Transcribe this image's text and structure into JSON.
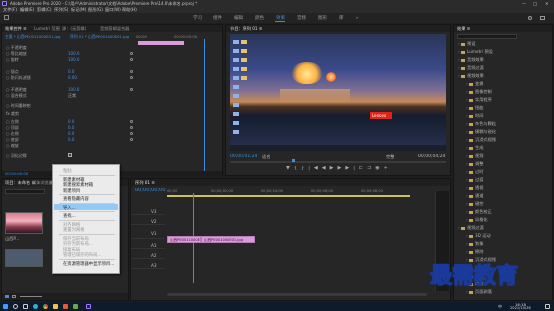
{
  "window": {
    "title": "Adobe Premiere Pro 2020 - C:\\用户\\Administrator\\文档\\Adobe\\Premiere Pro\\14.0\\未命名.prproj *"
  },
  "menubar": [
    "文件(F)",
    "编辑(E)",
    "剪辑(C)",
    "序列(S)",
    "标记(M)",
    "图形(G)",
    "窗口(W)",
    "帮助(H)"
  ],
  "workspaces": [
    {
      "label": "学习",
      "active": false
    },
    {
      "label": "组件",
      "active": false
    },
    {
      "label": "编辑",
      "active": false
    },
    {
      "label": "颜色",
      "active": false
    },
    {
      "label": "效果",
      "active": true
    },
    {
      "label": "音频",
      "active": false
    },
    {
      "label": "图形",
      "active": false
    },
    {
      "label": "库",
      "active": false
    }
  ],
  "effect_controls": {
    "tabs": [
      "效果控件 ≡",
      "Lumetri 范围",
      "源：(无剪辑)",
      "音频剪辑混合器"
    ],
    "source_label": "主要 * 山西PE0011000E01.jpg",
    "seq_label": "序列 01 * 山西PE001000E01.jpg",
    "timecode_left": "00:00",
    "timecode_right": "00:00:05:00",
    "rows": [
      {
        "label": "○ 不透明度",
        "value": ""
      },
      {
        "label": "  ○ 等比缩放",
        "value": "100.0"
      },
      {
        "label": "  ○ 旋转",
        "value": "100.0"
      },
      {
        "label": "  ○ 锚点",
        "value": "0.0"
      },
      {
        "label": "  ○ 防闪烁滤镜",
        "value": "0.00"
      },
      {
        "label": "○ 不透明度",
        "value": "100.0"
      },
      {
        "label": "  ○ 混合模式",
        "value": "正常"
      },
      {
        "label": "  ○ 时间重映射",
        "value": ""
      },
      {
        "label": "fx 裁剪",
        "value": ""
      },
      {
        "label": "  ○ 左侧",
        "value": "0.0"
      },
      {
        "label": "  ○ 顶部",
        "value": "0.0"
      },
      {
        "label": "  ○ 右侧",
        "value": "0.0"
      },
      {
        "label": "  ○ 底部",
        "value": "0.0"
      },
      {
        "label": "  ○ 缩放",
        "value": ""
      },
      {
        "label": "  ○ 羽化边缘",
        "value": "0"
      }
    ],
    "footer": "00:00:00:00"
  },
  "program": {
    "tabs": [
      "节目：序列 01 ≡"
    ],
    "timecode": "00;00;01;24",
    "fit": "适合",
    "quality": "完整",
    "duration": "00;00;04;24",
    "watermark": "Lenovo"
  },
  "effects": {
    "tabs": [
      "效果 ≡"
    ],
    "search_placeholder": "",
    "items": [
      {
        "label": "预设",
        "level": 0
      },
      {
        "label": "Lumetri 预设",
        "level": 0
      },
      {
        "label": "音频效果",
        "level": 0
      },
      {
        "label": "音频过渡",
        "level": 0
      },
      {
        "label": "视频效果",
        "level": 0
      },
      {
        "label": "变换",
        "level": 1
      },
      {
        "label": "图像控制",
        "level": 1
      },
      {
        "label": "实用程序",
        "level": 1
      },
      {
        "label": "扭曲",
        "level": 1
      },
      {
        "label": "时间",
        "level": 1
      },
      {
        "label": "杂色与颗粒",
        "level": 1
      },
      {
        "label": "模糊与锐化",
        "level": 1
      },
      {
        "label": "沉浸式视频",
        "level": 1
      },
      {
        "label": "生成",
        "level": 1
      },
      {
        "label": "视频",
        "level": 1
      },
      {
        "label": "调整",
        "level": 1
      },
      {
        "label": "过时",
        "level": 1
      },
      {
        "label": "过渡",
        "level": 1
      },
      {
        "label": "透视",
        "level": 1
      },
      {
        "label": "通道",
        "level": 1
      },
      {
        "label": "键控",
        "level": 1
      },
      {
        "label": "颜色校正",
        "level": 1
      },
      {
        "label": "风格化",
        "level": 1
      },
      {
        "label": "视频过渡",
        "level": 0
      },
      {
        "label": "3D 运动",
        "level": 1
      },
      {
        "label": "划像",
        "level": 1
      },
      {
        "label": "擦除",
        "level": 1
      },
      {
        "label": "沉浸式视频",
        "level": 1
      },
      {
        "label": "溶解",
        "level": 1
      },
      {
        "label": "滑动",
        "level": 1
      },
      {
        "label": "缩放",
        "level": 1
      },
      {
        "label": "页面剥落",
        "level": 1
      }
    ]
  },
  "project": {
    "tabs": [
      "项目：未命名 ≡",
      "媒体浏览器",
      "库"
    ],
    "item_label": "山西P..."
  },
  "context_menu": {
    "items": [
      {
        "label": "粘贴",
        "disabled": true
      },
      {
        "sep": true
      },
      {
        "label": "新建素材箱",
        "disabled": false
      },
      {
        "label": "新建搜索素材箱",
        "disabled": false
      },
      {
        "label": "新建项目",
        "disabled": false
      },
      {
        "sep": true
      },
      {
        "label": "查看隐藏内容",
        "disabled": false
      },
      {
        "sep": true
      },
      {
        "label": "导入...",
        "disabled": false,
        "highlight": true
      },
      {
        "sep": true
      },
      {
        "label": "查找...",
        "disabled": false
      },
      {
        "sep": true
      },
      {
        "label": "对齐网格",
        "disabled": true
      },
      {
        "label": "重置为网格",
        "disabled": true
      },
      {
        "sep": true
      },
      {
        "label": "保存当前布局",
        "disabled": true
      },
      {
        "label": "另存为新布局...",
        "disabled": true
      },
      {
        "label": "恢复布局",
        "disabled": true
      },
      {
        "label": "管理已保存的布局...",
        "disabled": true
      },
      {
        "sep": true
      },
      {
        "label": "在资源管理器中显示项目...",
        "disabled": false
      }
    ]
  },
  "timeline": {
    "tabs": [
      "序列 01 ≡"
    ],
    "timecode": "00;00;00;00",
    "ruler": [
      "00;00",
      "00;00;02;00",
      "00;00;04;00",
      "00;00;06;00",
      "00;00;08;00"
    ],
    "tracks": [
      "V3",
      "V2",
      "V1",
      "A1",
      "A2",
      "A3"
    ],
    "clips": [
      {
        "label": "山西PE0011000E01.jpg",
        "track": "V1"
      },
      {
        "label": "山西PE001000E01.jpg",
        "track": "V1"
      }
    ]
  },
  "taskbar": {
    "time": "16:18",
    "date": "2021/10/26",
    "lang": "中"
  },
  "watermark": {
    "text": "最需教育"
  },
  "colors": {
    "accent": "#3e8ee0",
    "clip": "#d99bd9"
  }
}
